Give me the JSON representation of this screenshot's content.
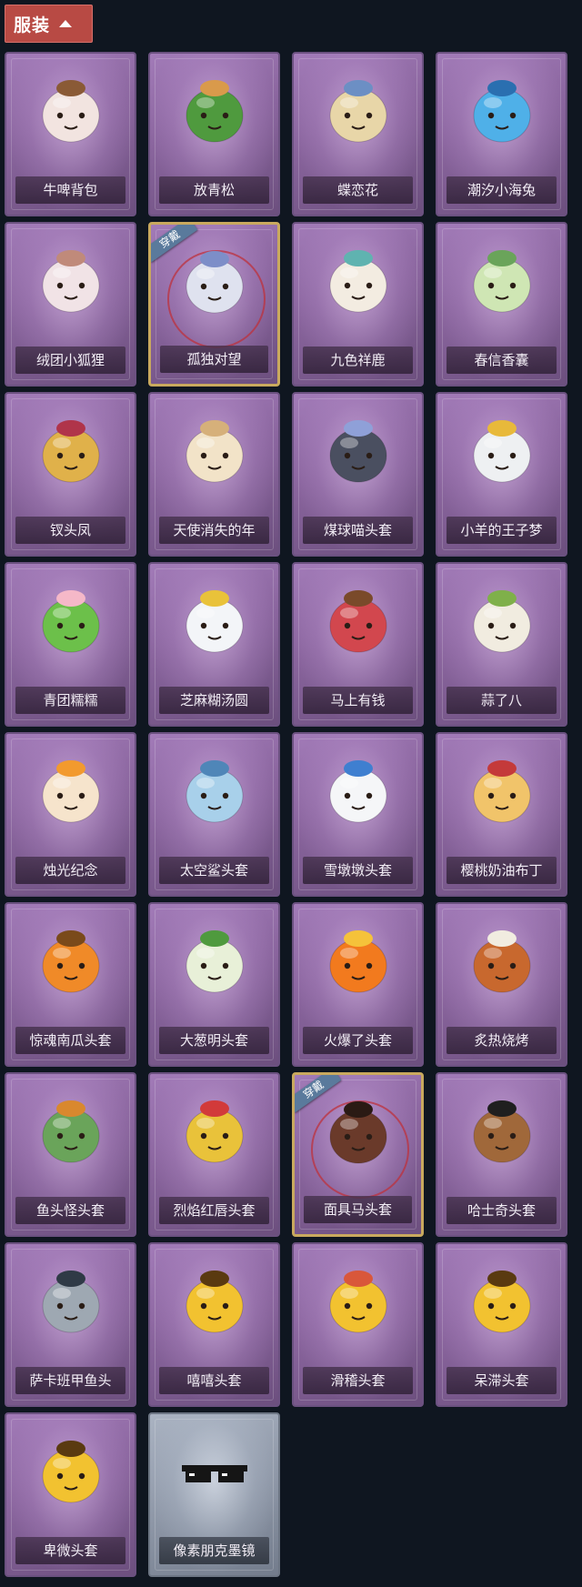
{
  "header": {
    "tab_label": "服装"
  },
  "colors": {
    "page_bg": "#0f1620",
    "tab_bg": "#b84a44",
    "card_purple": "#8a659e",
    "card_grey": "#8f98a8",
    "equipped_border": "#c9a95e",
    "equipped_badge": "#5a7a9c"
  },
  "items": [
    {
      "name": "牛啤背包",
      "icon": "cow-barrel-backpack-icon",
      "bg": "#f2e4e0",
      "accent": "#8a5a36",
      "equipped": false,
      "grey": false
    },
    {
      "name": "放青松",
      "icon": "potted-pine-icon",
      "bg": "#4f9a3e",
      "accent": "#d99a4b",
      "equipped": false,
      "grey": false
    },
    {
      "name": "蝶恋花",
      "icon": "butterfly-bell-charm-icon",
      "bg": "#e8d6a8",
      "accent": "#6c8fc4",
      "equipped": false,
      "grey": false
    },
    {
      "name": "潮汐小海兔",
      "icon": "blue-sea-rabbit-icon",
      "bg": "#4fb0e8",
      "accent": "#2a6fb0",
      "equipped": false,
      "grey": false
    },
    {
      "name": "绒团小狐狸",
      "icon": "fluffy-fox-icon",
      "bg": "#f1e3e6",
      "accent": "#c08a7a",
      "equipped": false,
      "grey": false
    },
    {
      "name": "孤独对望",
      "icon": "lonely-gaze-charm-icon",
      "bg": "#dfe2ef",
      "accent": "#7d8ec8",
      "equipped": true,
      "badge": "穿戴",
      "grey": false
    },
    {
      "name": "九色祥鹿",
      "icon": "nine-color-deer-icon",
      "bg": "#f3ece1",
      "accent": "#5fb3b0",
      "equipped": false,
      "grey": false
    },
    {
      "name": "春信香囊",
      "icon": "spring-sachet-icon",
      "bg": "#cfe6b4",
      "accent": "#6aa45a",
      "equipped": false,
      "grey": false
    },
    {
      "name": "钗头凤",
      "icon": "phoenix-hairpin-doll-icon",
      "bg": "#e0b14a",
      "accent": "#b0344a",
      "equipped": false,
      "grey": false
    },
    {
      "name": "天使消失的年",
      "icon": "angel-doll-icon",
      "bg": "#f2e3c8",
      "accent": "#d6b07a",
      "equipped": false,
      "grey": false
    },
    {
      "name": "煤球喵头套",
      "icon": "black-cat-head-icon",
      "bg": "#4a4f60",
      "accent": "#8fa0d8",
      "equipped": false,
      "grey": false
    },
    {
      "name": "小羊的王子梦",
      "icon": "prince-sheep-head-icon",
      "bg": "#eef0f2",
      "accent": "#e8b93a",
      "equipped": false,
      "grey": false
    },
    {
      "name": "青团糯糯",
      "icon": "green-rice-ball-icon",
      "bg": "#6cc04a",
      "accent": "#f5b8c8",
      "equipped": false,
      "grey": false
    },
    {
      "name": "芝麻糊汤圆",
      "icon": "sesame-dumpling-icon",
      "bg": "#f3f5f8",
      "accent": "#e9c23a",
      "equipped": false,
      "grey": false
    },
    {
      "name": "马上有钱",
      "icon": "red-horse-head-icon",
      "bg": "#d2474e",
      "accent": "#7a4a2a",
      "equipped": false,
      "grey": false
    },
    {
      "name": "蒜了八",
      "icon": "garlic-head-icon",
      "bg": "#f1ece0",
      "accent": "#7fb04a",
      "equipped": false,
      "grey": false
    },
    {
      "name": "烛光纪念",
      "icon": "candle-head-icon",
      "bg": "#f6e4cc",
      "accent": "#f29a2e",
      "equipped": false,
      "grey": false
    },
    {
      "name": "太空鲨头套",
      "icon": "space-shark-head-icon",
      "bg": "#a8d0ea",
      "accent": "#4f86b8",
      "equipped": false,
      "grey": false
    },
    {
      "name": "雪墩墩头套",
      "icon": "snowman-head-icon",
      "bg": "#f5f6f8",
      "accent": "#3f7fd0",
      "equipped": false,
      "grey": false
    },
    {
      "name": "樱桃奶油布丁",
      "icon": "cherry-pudding-head-icon",
      "bg": "#f1c46a",
      "accent": "#c43a3a",
      "equipped": false,
      "grey": false
    },
    {
      "name": "惊魂南瓜头套",
      "icon": "pumpkin-head-icon",
      "bg": "#f08a28",
      "accent": "#7a4a1a",
      "equipped": false,
      "grey": false
    },
    {
      "name": "大葱明头套",
      "icon": "scallion-head-icon",
      "bg": "#e8f0d8",
      "accent": "#4f9a3e",
      "equipped": false,
      "grey": false
    },
    {
      "name": "火爆了头套",
      "icon": "fire-head-icon",
      "bg": "#f27a1e",
      "accent": "#f5c23a",
      "equipped": false,
      "grey": false
    },
    {
      "name": "炙热烧烤",
      "icon": "bbq-meat-head-icon",
      "bg": "#c8682e",
      "accent": "#f1ece0",
      "equipped": false,
      "grey": false
    },
    {
      "name": "鱼头怪头套",
      "icon": "fish-monster-head-icon",
      "bg": "#6aa45a",
      "accent": "#d9882e",
      "equipped": false,
      "grey": false
    },
    {
      "name": "烈焰红唇头套",
      "icon": "red-lips-head-icon",
      "bg": "#e9c23a",
      "accent": "#d23a3a",
      "equipped": false,
      "grey": false
    },
    {
      "name": "面具马头套",
      "icon": "horse-mask-head-icon",
      "bg": "#6a3a2a",
      "accent": "#2a1a14",
      "equipped": true,
      "badge": "穿戴",
      "grey": false
    },
    {
      "name": "哈士奇头套",
      "icon": "husky-head-icon",
      "bg": "#a0683a",
      "accent": "#1f1f1f",
      "equipped": false,
      "grey": false
    },
    {
      "name": "萨卡班甲鱼头",
      "icon": "sacabambaspis-head-icon",
      "bg": "#9ea8b2",
      "accent": "#2f3a46",
      "equipped": false,
      "grey": false
    },
    {
      "name": "嘻嘻头套",
      "icon": "grin-emoji-head-icon",
      "bg": "#f2c230",
      "accent": "#5a3a10",
      "equipped": false,
      "grey": false
    },
    {
      "name": "滑稽头套",
      "icon": "funny-emoji-head-icon",
      "bg": "#f2c230",
      "accent": "#d9573a",
      "equipped": false,
      "grey": false
    },
    {
      "name": "呆滞头套",
      "icon": "dazed-emoji-head-icon",
      "bg": "#f2c230",
      "accent": "#5a3a10",
      "equipped": false,
      "grey": false
    },
    {
      "name": "卑微头套",
      "icon": "humble-emoji-head-icon",
      "bg": "#f2c230",
      "accent": "#5a3a10",
      "equipped": false,
      "grey": false
    },
    {
      "name": "像素朋克墨镜",
      "icon": "pixel-sunglasses-icon",
      "bg": "#151515",
      "accent": "#151515",
      "equipped": false,
      "grey": true
    }
  ]
}
